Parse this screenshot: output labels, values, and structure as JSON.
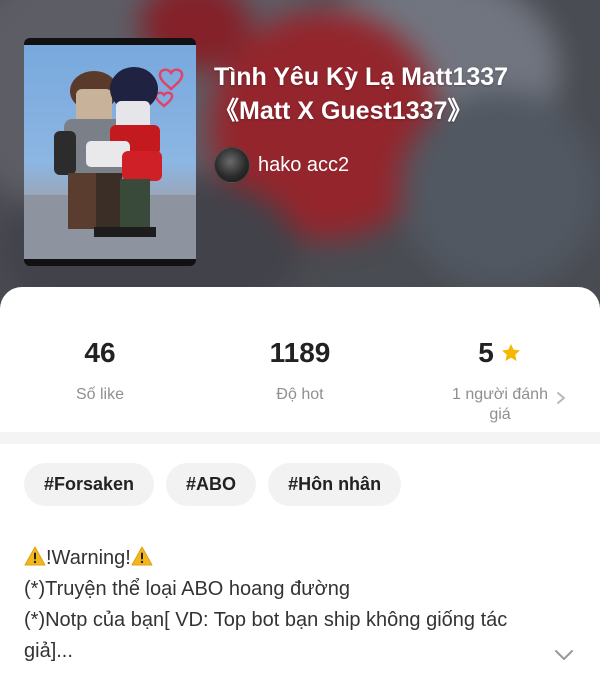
{
  "story": {
    "title_line1": "Tình Yêu Kỳ Lạ Matt1337",
    "title_line2": "《Matt X Guest1337》",
    "author": "hako acc2"
  },
  "stats": [
    {
      "value": "46",
      "label": "Số like"
    },
    {
      "value": "1189",
      "label": "Độ hot"
    },
    {
      "value": "5",
      "label": "1 người đánh giá",
      "icon": "star-icon"
    }
  ],
  "tags": [
    "#Forsaken",
    "#ABO",
    "#Hôn nhân"
  ],
  "description": {
    "warning": "!Warning!",
    "line2": "(*)Truyện thể loại ABO hoang đường",
    "line3": "(*)Notp của bạn[ VD: Top bot bạn ship không giống tác",
    "line4": "giả]..."
  },
  "colors": {
    "star": "#f5b800",
    "warning": "#f2b71b",
    "chip_bg": "#f2f2f2",
    "label": "#8f8f8f"
  }
}
